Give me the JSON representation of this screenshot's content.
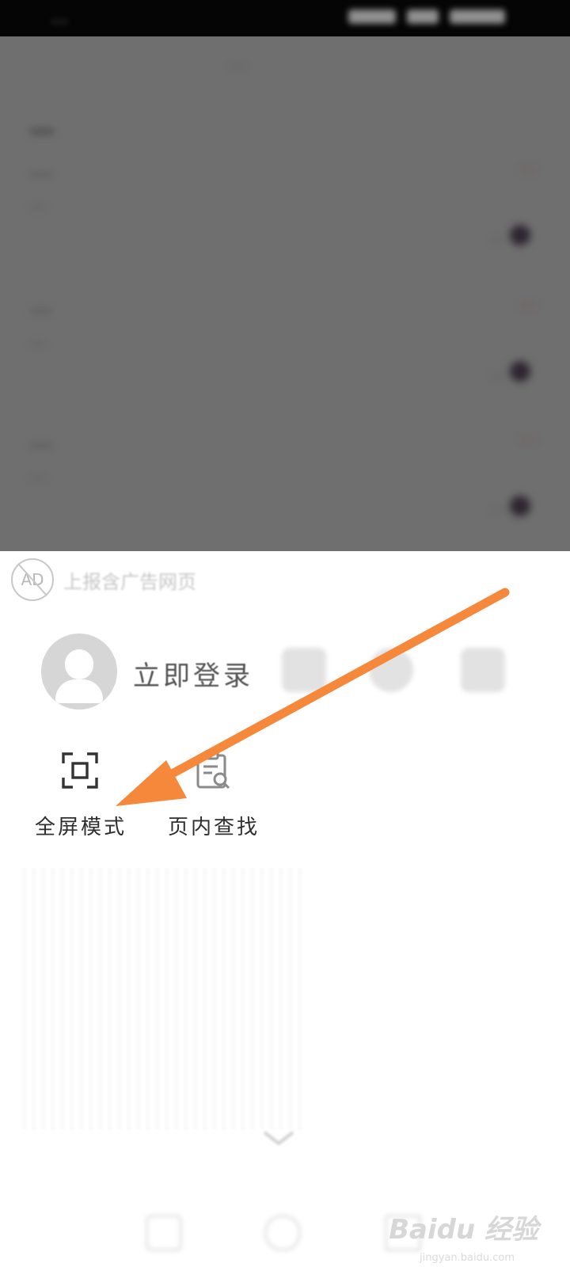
{
  "status_bar": {
    "time": "…"
  },
  "page": {
    "top_title": "…",
    "hot_title": "…",
    "news": [
      {
        "title": "…",
        "tag": "…",
        "desc": "…",
        "meta": "…"
      },
      {
        "title": "…",
        "tag": "…",
        "desc": "…",
        "meta": "…"
      },
      {
        "title": "…",
        "tag": "…",
        "desc": "…",
        "meta": "…"
      }
    ]
  },
  "sheet": {
    "ad_badge": "AD",
    "ad_text": "上报含广告网页",
    "login_label": "立即登录",
    "tools": [
      {
        "label": "全屏模式",
        "icon": "fullscreen-icon"
      },
      {
        "label": "页内查找",
        "icon": "find-in-page-icon"
      }
    ]
  },
  "watermark": {
    "brand": "Baidu 经验",
    "url": "jingyan.baidu.com"
  },
  "colors": {
    "arrow": "#F5883B",
    "overlay": "#6f6f6f",
    "sheet_bg": "#ffffff",
    "text": "#2f2f2f"
  }
}
